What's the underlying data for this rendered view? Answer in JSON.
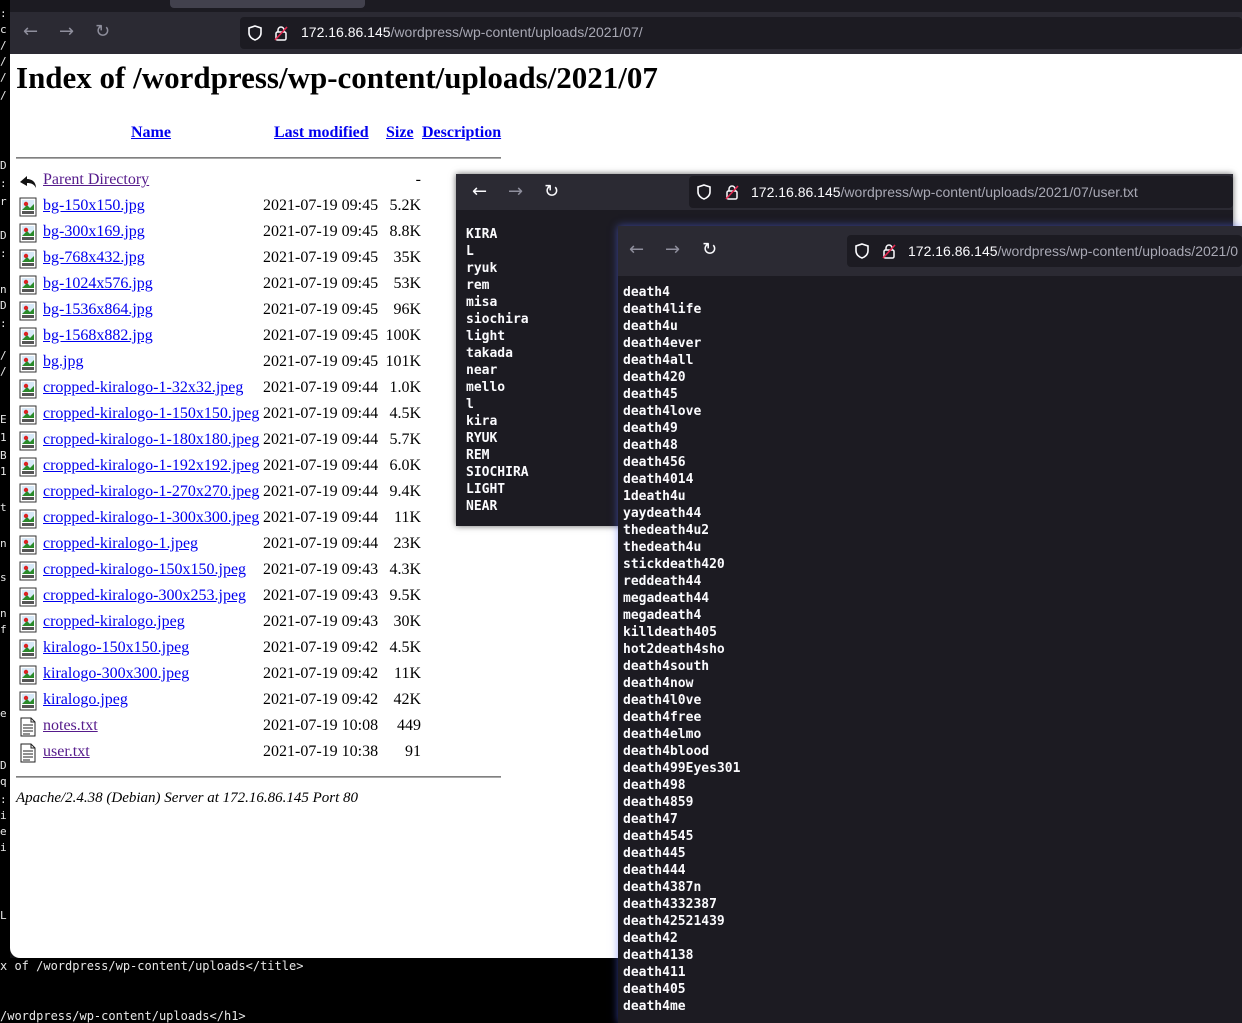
{
  "terminal": {
    "left_chars": [
      ":",
      "c",
      "/",
      "/",
      "/",
      "/",
      "D",
      ":",
      "r",
      "D",
      ":",
      "n",
      "D",
      ":",
      "/",
      "/",
      "E",
      "1",
      "B",
      "1",
      "t",
      "n",
      "s",
      "n",
      "f",
      "e",
      "D",
      "q",
      ":",
      "i",
      "e",
      "i",
      "L"
    ],
    "bottom_line1": "x of /wordpress/wp-content/uploads</title>",
    "bottom_line2": "/wordpress/wp-content/uploads</h1>"
  },
  "window1": {
    "url_host": "172.16.86.145",
    "url_path": "/wordpress/wp-content/uploads/2021/07/",
    "heading": "Index of /wordpress/wp-content/uploads/2021/07",
    "columns": {
      "name": "Name",
      "modified": "Last modified",
      "size": "Size",
      "description": "Description"
    },
    "parent": {
      "name": "Parent Directory",
      "size": "-"
    },
    "files": [
      {
        "name": "bg-150x150.jpg",
        "modified": "2021-07-19 09:45",
        "size": "5.2K",
        "icon": "image-icon"
      },
      {
        "name": "bg-300x169.jpg",
        "modified": "2021-07-19 09:45",
        "size": "8.8K",
        "icon": "image-icon"
      },
      {
        "name": "bg-768x432.jpg",
        "modified": "2021-07-19 09:45",
        "size": "35K",
        "icon": "image-icon"
      },
      {
        "name": "bg-1024x576.jpg",
        "modified": "2021-07-19 09:45",
        "size": "53K",
        "icon": "image-icon"
      },
      {
        "name": "bg-1536x864.jpg",
        "modified": "2021-07-19 09:45",
        "size": "96K",
        "icon": "image-icon"
      },
      {
        "name": "bg-1568x882.jpg",
        "modified": "2021-07-19 09:45",
        "size": "100K",
        "icon": "image-icon"
      },
      {
        "name": "bg.jpg",
        "modified": "2021-07-19 09:45",
        "size": "101K",
        "icon": "image-icon"
      },
      {
        "name": "cropped-kiralogo-1-32x32.jpeg",
        "modified": "2021-07-19 09:44",
        "size": "1.0K",
        "icon": "image-icon"
      },
      {
        "name": "cropped-kiralogo-1-150x150.jpeg",
        "modified": "2021-07-19 09:44",
        "size": "4.5K",
        "icon": "image-icon"
      },
      {
        "name": "cropped-kiralogo-1-180x180.jpeg",
        "modified": "2021-07-19 09:44",
        "size": "5.7K",
        "icon": "image-icon"
      },
      {
        "name": "cropped-kiralogo-1-192x192.jpeg",
        "modified": "2021-07-19 09:44",
        "size": "6.0K",
        "icon": "image-icon"
      },
      {
        "name": "cropped-kiralogo-1-270x270.jpeg",
        "modified": "2021-07-19 09:44",
        "size": "9.4K",
        "icon": "image-icon"
      },
      {
        "name": "cropped-kiralogo-1-300x300.jpeg",
        "modified": "2021-07-19 09:44",
        "size": "11K",
        "icon": "image-icon"
      },
      {
        "name": "cropped-kiralogo-1.jpeg",
        "modified": "2021-07-19 09:44",
        "size": "23K",
        "icon": "image-icon"
      },
      {
        "name": "cropped-kiralogo-150x150.jpeg",
        "modified": "2021-07-19 09:43",
        "size": "4.3K",
        "icon": "image-icon"
      },
      {
        "name": "cropped-kiralogo-300x253.jpeg",
        "modified": "2021-07-19 09:43",
        "size": "9.5K",
        "icon": "image-icon"
      },
      {
        "name": "cropped-kiralogo.jpeg",
        "modified": "2021-07-19 09:43",
        "size": "30K",
        "icon": "image-icon"
      },
      {
        "name": "kiralogo-150x150.jpeg",
        "modified": "2021-07-19 09:42",
        "size": "4.5K",
        "icon": "image-icon"
      },
      {
        "name": "kiralogo-300x300.jpeg",
        "modified": "2021-07-19 09:42",
        "size": "11K",
        "icon": "image-icon"
      },
      {
        "name": "kiralogo.jpeg",
        "modified": "2021-07-19 09:42",
        "size": "42K",
        "icon": "image-icon"
      },
      {
        "name": "notes.txt",
        "modified": "2021-07-19 10:08",
        "size": "449",
        "icon": "text-file-icon"
      },
      {
        "name": "user.txt",
        "modified": "2021-07-19 10:38",
        "size": "91",
        "icon": "text-file-icon"
      }
    ],
    "footer": "Apache/2.4.38 (Debian) Server at 172.16.86.145 Port 80"
  },
  "window2": {
    "url_host": "172.16.86.145",
    "url_path": "/wordpress/wp-content/uploads/2021/07/user.txt",
    "lines": [
      "KIRA",
      "L",
      "ryuk",
      "rem",
      "misa",
      "siochira",
      "light",
      "takada",
      "near",
      "mello",
      "l",
      "kira",
      "RYUK",
      "REM",
      "SIOCHIRA",
      "LIGHT",
      "NEAR"
    ]
  },
  "window3": {
    "url_host": "172.16.86.145",
    "url_path": "/wordpress/wp-content/uploads/2021/0",
    "lines": [
      "death4",
      "death4life",
      "death4u",
      "death4ever",
      "death4all",
      "death420",
      "death45",
      "death4love",
      "death49",
      "death48",
      "death456",
      "death4014",
      "1death4u",
      "yaydeath44",
      "thedeath4u2",
      "thedeath4u",
      "stickdeath420",
      "reddeath44",
      "megadeath44",
      "megadeath4",
      "killdeath405",
      "hot2death4sho",
      "death4south",
      "death4now",
      "death4l0ve",
      "death4free",
      "death4elmo",
      "death4blood",
      "death499Eyes301",
      "death498",
      "death4859",
      "death47",
      "death4545",
      "death445",
      "death444",
      "death4387n",
      "death4332387",
      "death42521439",
      "death42",
      "death4138",
      "death411",
      "death405",
      "death4me"
    ]
  },
  "colors": {
    "link": "#0000ee",
    "visited": "#551a8b",
    "toolbar": "#2b2a33",
    "content_dark": "#1c1b22"
  }
}
